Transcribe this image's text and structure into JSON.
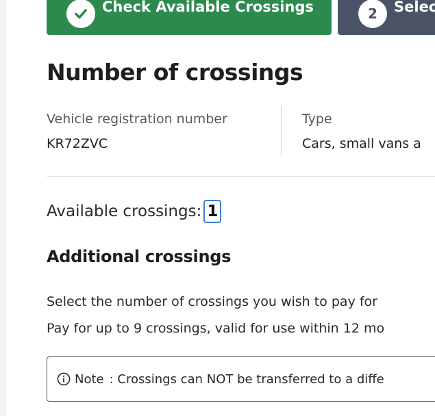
{
  "steps": [
    {
      "number": "",
      "label": "Check Available Crossings",
      "state": "complete",
      "color": "#2d8a4e"
    },
    {
      "number": "2",
      "label": "Select",
      "state": "pending",
      "color": "#4a5466"
    }
  ],
  "page_title": "Number of crossings",
  "vehicle": {
    "registration_label": "Vehicle registration number",
    "registration_value": "KR72ZVC",
    "type_label": "Type",
    "type_value": "Cars, small vans a"
  },
  "available": {
    "label": "Available crossings:",
    "count": "1"
  },
  "additional": {
    "heading": "Additional crossings",
    "line1": "Select the number of crossings you wish to pay for",
    "line2": "Pay for up to 9 crossings, valid for use within 12 mo"
  },
  "note": {
    "icon": "info-icon",
    "label": "Note",
    "text": ": Crossings can NOT be transferred to a diffe"
  }
}
